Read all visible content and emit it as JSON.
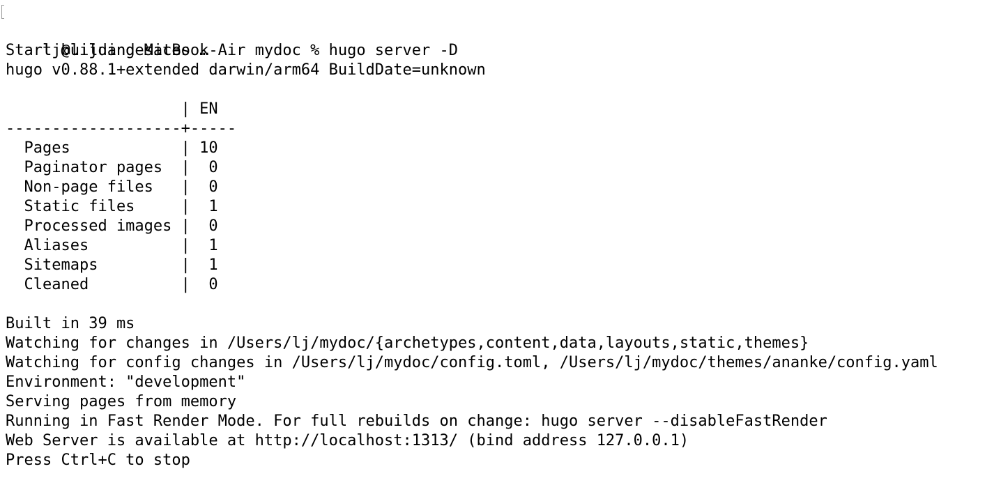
{
  "terminal": {
    "prompt": "lj@lijuandeMacBook-Air mydoc % hugo server -D",
    "lines": [
      "",
      "Start building sites …",
      "hugo v0.88.1+extended darwin/arm64 BuildDate=unknown",
      "",
      "                   | EN",
      "-------------------+-----",
      "  Pages            | 10",
      "  Paginator pages  |  0",
      "  Non-page files   |  0",
      "  Static files     |  1",
      "  Processed images |  0",
      "  Aliases          |  1",
      "  Sitemaps         |  1",
      "  Cleaned          |  0",
      "",
      "Built in 39 ms",
      "Watching for changes in /Users/lj/mydoc/{archetypes,content,data,layouts,static,themes}",
      "Watching for config changes in /Users/lj/mydoc/config.toml, /Users/lj/mydoc/themes/ananke/config.yaml",
      "Environment: \"development\"",
      "Serving pages from memory",
      "Running in Fast Render Mode. For full rebuilds on change: hugo server --disableFastRender",
      "Web Server is available at http://localhost:1313/ (bind address 127.0.0.1)",
      "Press Ctrl+C to stop"
    ]
  }
}
